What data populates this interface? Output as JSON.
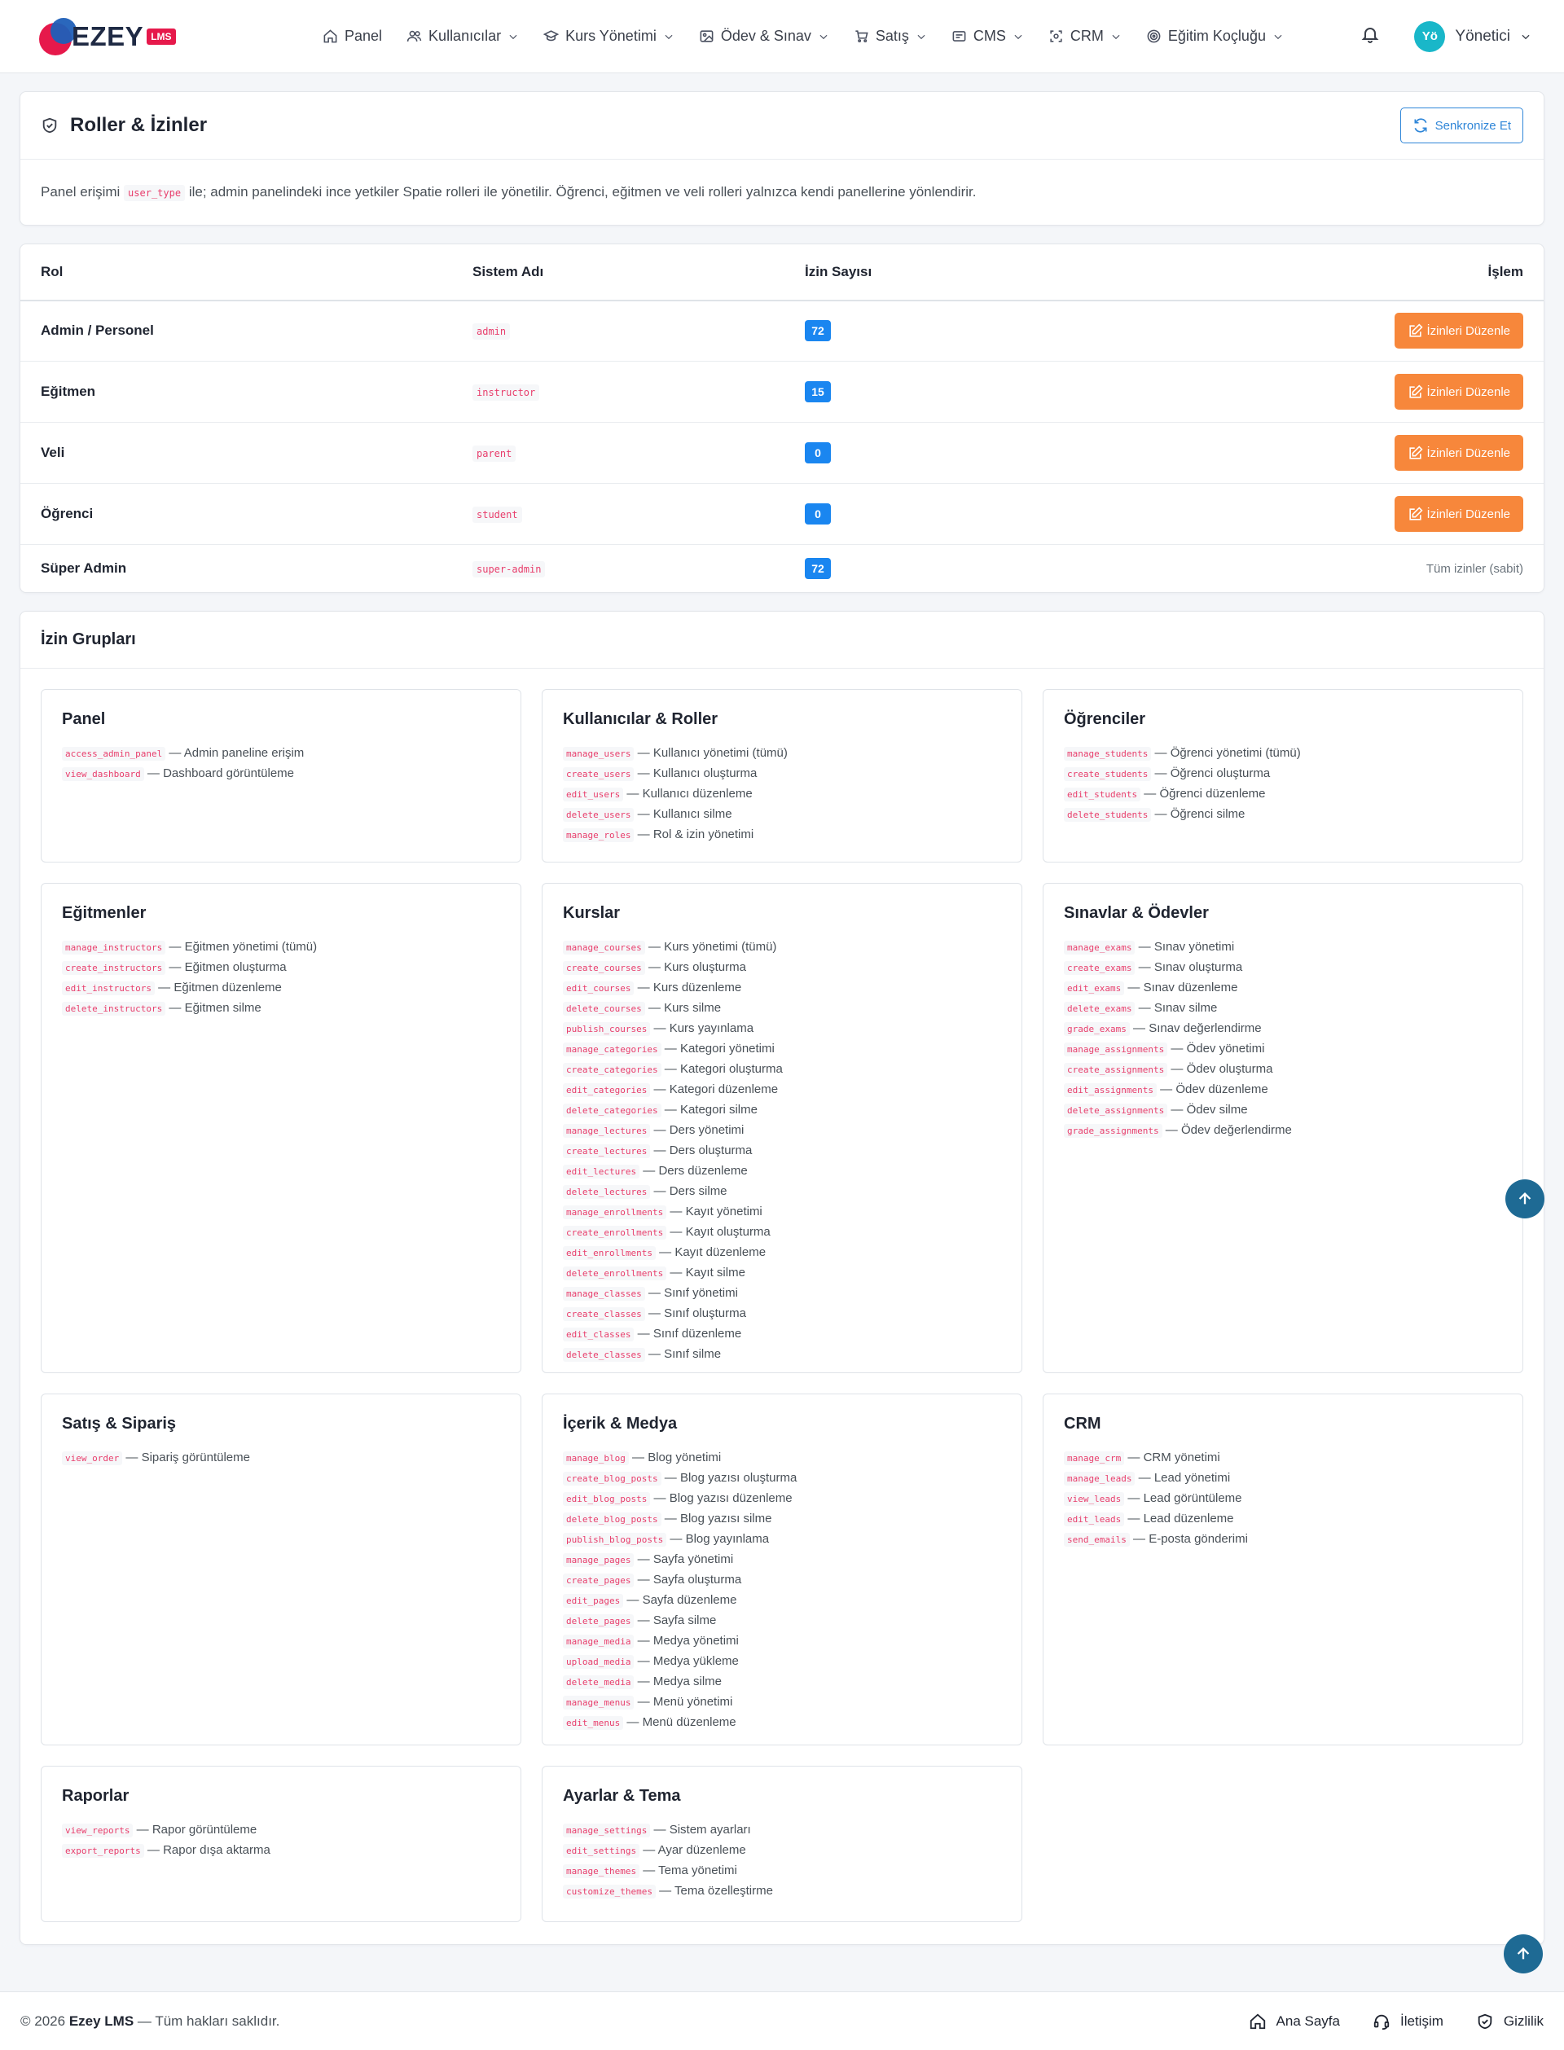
{
  "nav": {
    "logo_text": "EZEY",
    "logo_badge": "LMS",
    "items": [
      {
        "label": "Panel",
        "icon": "home-icon",
        "dropdown": false
      },
      {
        "label": "Kullanıcılar",
        "icon": "users-icon",
        "dropdown": true
      },
      {
        "label": "Kurs Yönetimi",
        "icon": "graduation-cap-icon",
        "dropdown": true
      },
      {
        "label": "Ödev & Sınav",
        "icon": "image-icon",
        "dropdown": true
      },
      {
        "label": "Satış",
        "icon": "cart-icon",
        "dropdown": true
      },
      {
        "label": "CMS",
        "icon": "card-icon",
        "dropdown": true
      },
      {
        "label": "CRM",
        "icon": "scan-icon",
        "dropdown": true
      },
      {
        "label": "Eğitim Koçluğu",
        "icon": "target-icon",
        "dropdown": true
      }
    ],
    "user_initials": "Yö",
    "user_name": "Yönetici"
  },
  "roles_card": {
    "title": "Roller & İzinler",
    "sync_label": "Senkronize Et",
    "desc_before": "Panel erişimi",
    "desc_code": "user_type",
    "desc_after": "ile; admin panelindeki ince yetkiler Spatie rolleri ile yönetilir. Öğrenci, eğitmen ve veli rolleri yalnızca kendi panellerine yönlendirir."
  },
  "roles_table": {
    "headers": {
      "role": "Rol",
      "system": "Sistem Adı",
      "count": "İzin Sayısı",
      "action": "İşlem"
    },
    "edit_label": "İzinleri Düzenle",
    "rows": [
      {
        "name": "Admin / Personel",
        "system": "admin",
        "count": "72"
      },
      {
        "name": "Eğitmen",
        "system": "instructor",
        "count": "15"
      },
      {
        "name": "Veli",
        "system": "parent",
        "count": "0"
      },
      {
        "name": "Öğrenci",
        "system": "student",
        "count": "0"
      },
      {
        "name": "Süper Admin",
        "system": "super-admin",
        "count": "72",
        "fixed": "Tüm izinler (sabit)"
      }
    ]
  },
  "groups": {
    "title": "İzin Grupları",
    "items": [
      {
        "title": "Panel",
        "perms": [
          [
            "access_admin_panel",
            "Admin paneline erişim"
          ],
          [
            "view_dashboard",
            "Dashboard görüntüleme"
          ]
        ]
      },
      {
        "title": "Kullanıcılar & Roller",
        "perms": [
          [
            "manage_users",
            "Kullanıcı yönetimi (tümü)"
          ],
          [
            "create_users",
            "Kullanıcı oluşturma"
          ],
          [
            "edit_users",
            "Kullanıcı düzenleme"
          ],
          [
            "delete_users",
            "Kullanıcı silme"
          ],
          [
            "manage_roles",
            "Rol & izin yönetimi"
          ]
        ]
      },
      {
        "title": "Öğrenciler",
        "perms": [
          [
            "manage_students",
            "Öğrenci yönetimi (tümü)"
          ],
          [
            "create_students",
            "Öğrenci oluşturma"
          ],
          [
            "edit_students",
            "Öğrenci düzenleme"
          ],
          [
            "delete_students",
            "Öğrenci silme"
          ]
        ]
      },
      {
        "title": "Eğitmenler",
        "perms": [
          [
            "manage_instructors",
            "Eğitmen yönetimi (tümü)"
          ],
          [
            "create_instructors",
            "Eğitmen oluşturma"
          ],
          [
            "edit_instructors",
            "Eğitmen düzenleme"
          ],
          [
            "delete_instructors",
            "Eğitmen silme"
          ]
        ]
      },
      {
        "title": "Kurslar",
        "perms": [
          [
            "manage_courses",
            "Kurs yönetimi (tümü)"
          ],
          [
            "create_courses",
            "Kurs oluşturma"
          ],
          [
            "edit_courses",
            "Kurs düzenleme"
          ],
          [
            "delete_courses",
            "Kurs silme"
          ],
          [
            "publish_courses",
            "Kurs yayınlama"
          ],
          [
            "manage_categories",
            "Kategori yönetimi"
          ],
          [
            "create_categories",
            "Kategori oluşturma"
          ],
          [
            "edit_categories",
            "Kategori düzenleme"
          ],
          [
            "delete_categories",
            "Kategori silme"
          ],
          [
            "manage_lectures",
            "Ders yönetimi"
          ],
          [
            "create_lectures",
            "Ders oluşturma"
          ],
          [
            "edit_lectures",
            "Ders düzenleme"
          ],
          [
            "delete_lectures",
            "Ders silme"
          ],
          [
            "manage_enrollments",
            "Kayıt yönetimi"
          ],
          [
            "create_enrollments",
            "Kayıt oluşturma"
          ],
          [
            "edit_enrollments",
            "Kayıt düzenleme"
          ],
          [
            "delete_enrollments",
            "Kayıt silme"
          ],
          [
            "manage_classes",
            "Sınıf yönetimi"
          ],
          [
            "create_classes",
            "Sınıf oluşturma"
          ],
          [
            "edit_classes",
            "Sınıf düzenleme"
          ],
          [
            "delete_classes",
            "Sınıf silme"
          ]
        ]
      },
      {
        "title": "Sınavlar & Ödevler",
        "perms": [
          [
            "manage_exams",
            "Sınav yönetimi"
          ],
          [
            "create_exams",
            "Sınav oluşturma"
          ],
          [
            "edit_exams",
            "Sınav düzenleme"
          ],
          [
            "delete_exams",
            "Sınav silme"
          ],
          [
            "grade_exams",
            "Sınav değerlendirme"
          ],
          [
            "manage_assignments",
            "Ödev yönetimi"
          ],
          [
            "create_assignments",
            "Ödev oluşturma"
          ],
          [
            "edit_assignments",
            "Ödev düzenleme"
          ],
          [
            "delete_assignments",
            "Ödev silme"
          ],
          [
            "grade_assignments",
            "Ödev değerlendirme"
          ]
        ]
      },
      {
        "title": "Satış & Sipariş",
        "perms": [
          [
            "view_order",
            "Sipariş görüntüleme"
          ]
        ]
      },
      {
        "title": "İçerik & Medya",
        "perms": [
          [
            "manage_blog",
            "Blog yönetimi"
          ],
          [
            "create_blog_posts",
            "Blog yazısı oluşturma"
          ],
          [
            "edit_blog_posts",
            "Blog yazısı düzenleme"
          ],
          [
            "delete_blog_posts",
            "Blog yazısı silme"
          ],
          [
            "publish_blog_posts",
            "Blog yayınlama"
          ],
          [
            "manage_pages",
            "Sayfa yönetimi"
          ],
          [
            "create_pages",
            "Sayfa oluşturma"
          ],
          [
            "edit_pages",
            "Sayfa düzenleme"
          ],
          [
            "delete_pages",
            "Sayfa silme"
          ],
          [
            "manage_media",
            "Medya yönetimi"
          ],
          [
            "upload_media",
            "Medya yükleme"
          ],
          [
            "delete_media",
            "Medya silme"
          ],
          [
            "manage_menus",
            "Menü yönetimi"
          ],
          [
            "edit_menus",
            "Menü düzenleme"
          ]
        ]
      },
      {
        "title": "CRM",
        "perms": [
          [
            "manage_crm",
            "CRM yönetimi"
          ],
          [
            "manage_leads",
            "Lead yönetimi"
          ],
          [
            "view_leads",
            "Lead görüntüleme"
          ],
          [
            "edit_leads",
            "Lead düzenleme"
          ],
          [
            "send_emails",
            "E-posta gönderimi"
          ]
        ]
      },
      {
        "title": "Raporlar",
        "perms": [
          [
            "view_reports",
            "Rapor görüntüleme"
          ],
          [
            "export_reports",
            "Rapor dışa aktarma"
          ]
        ]
      },
      {
        "title": "Ayarlar & Tema",
        "perms": [
          [
            "manage_settings",
            "Sistem ayarları"
          ],
          [
            "edit_settings",
            "Ayar düzenleme"
          ],
          [
            "manage_themes",
            "Tema yönetimi"
          ],
          [
            "customize_themes",
            "Tema özelleştirme"
          ]
        ]
      }
    ]
  },
  "footer": {
    "copyright_prefix": "© 2026",
    "brand": "Ezey LMS",
    "copyright_suffix": "— Tüm hakları saklıdır.",
    "links": [
      {
        "label": "Ana Sayfa",
        "icon": "home-icon"
      },
      {
        "label": "İletişim",
        "icon": "headset-icon"
      },
      {
        "label": "Gizlilik",
        "icon": "shield-icon"
      }
    ]
  },
  "colors": {
    "primary": "#1a86f0",
    "accent": "#f7873b",
    "code": "#e83e6c",
    "brand_red": "#e6194b",
    "brand_blue": "#1f5fb8"
  }
}
